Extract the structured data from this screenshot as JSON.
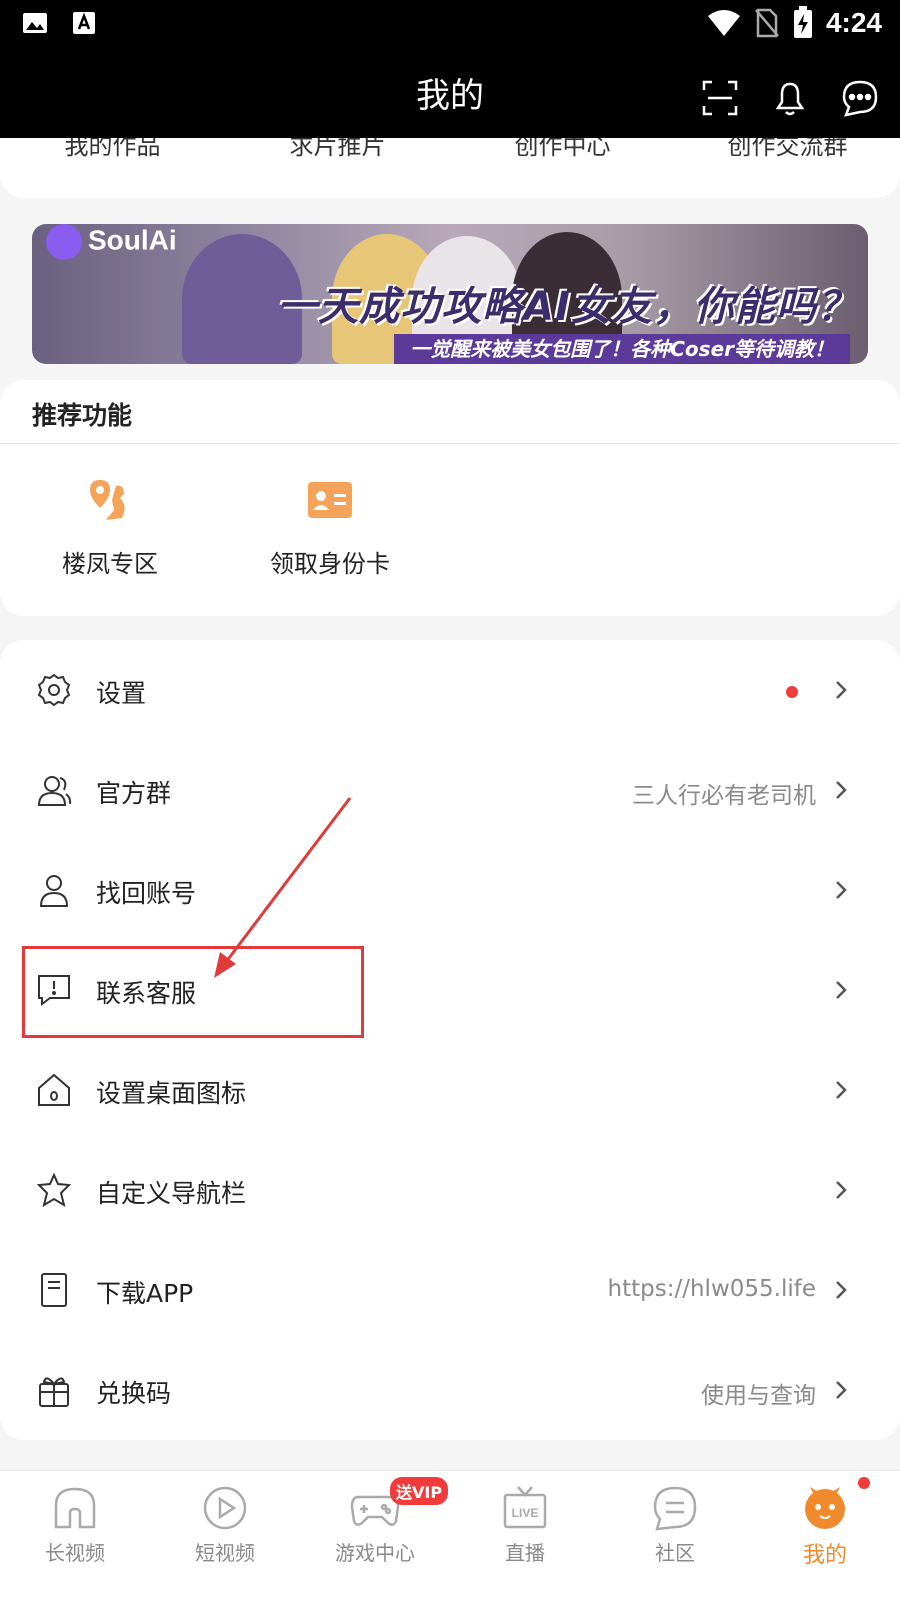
{
  "status": {
    "time": "4:24"
  },
  "header": {
    "title": "我的"
  },
  "works": {
    "items": [
      "我的作品",
      "求片推片",
      "创作中心",
      "创作交流群"
    ]
  },
  "banner": {
    "brand": "SoulAi",
    "headline": "一天成功攻略AI女友，你能吗？",
    "subline": "一觉醒来被美女包围了！各种Coser等待调教！"
  },
  "recommend": {
    "title": "推荐功能",
    "items": [
      {
        "label": "楼凤专区",
        "icon": "location-girl-icon"
      },
      {
        "label": "领取身份卡",
        "icon": "id-card-icon"
      }
    ]
  },
  "menu": {
    "items": [
      {
        "label": "设置",
        "value": "",
        "icon": "gear-icon",
        "dot": true
      },
      {
        "label": "官方群",
        "value": "三人行必有老司机",
        "icon": "users-icon"
      },
      {
        "label": "找回账号",
        "value": "",
        "icon": "user-icon"
      },
      {
        "label": "联系客服",
        "value": "",
        "icon": "chat-alert-icon"
      },
      {
        "label": "设置桌面图标",
        "value": "",
        "icon": "home-icon"
      },
      {
        "label": "自定义导航栏",
        "value": "",
        "icon": "star-icon"
      },
      {
        "label": "下载APP",
        "value": "https://hlw055.life",
        "icon": "document-icon"
      },
      {
        "label": "兑换码",
        "value": "使用与查询",
        "icon": "gift-icon"
      }
    ]
  },
  "nav": {
    "vip_badge": "送VIP",
    "items": [
      {
        "label": "长视频"
      },
      {
        "label": "短视频"
      },
      {
        "label": "游戏中心"
      },
      {
        "label": "直播"
      },
      {
        "label": "社区"
      },
      {
        "label": "我的"
      }
    ],
    "live_tag": "LIVE"
  },
  "colors": {
    "accent": "#f08a2c",
    "icon_orange": "#f6a35a",
    "alert_red": "#f23b3b",
    "annotation_red": "#e03a3a"
  }
}
